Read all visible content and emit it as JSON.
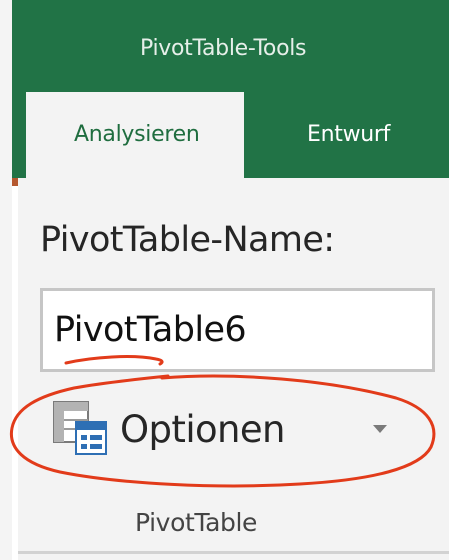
{
  "header": {
    "contextual_title": "PivotTable-Tools"
  },
  "tabs": [
    {
      "label": "Analysieren",
      "active": true
    },
    {
      "label": "Entwurf",
      "active": false
    }
  ],
  "pivot_name": {
    "label": "PivotTable-Name:",
    "value": "PivotTable6"
  },
  "options_button": {
    "label": "Optionen",
    "icon": "pivottable-options-icon",
    "dropdown": true
  },
  "group": {
    "label": "PivotTable"
  },
  "colors": {
    "accent_green": "#217346",
    "annotation_red": "#e23b1a"
  }
}
